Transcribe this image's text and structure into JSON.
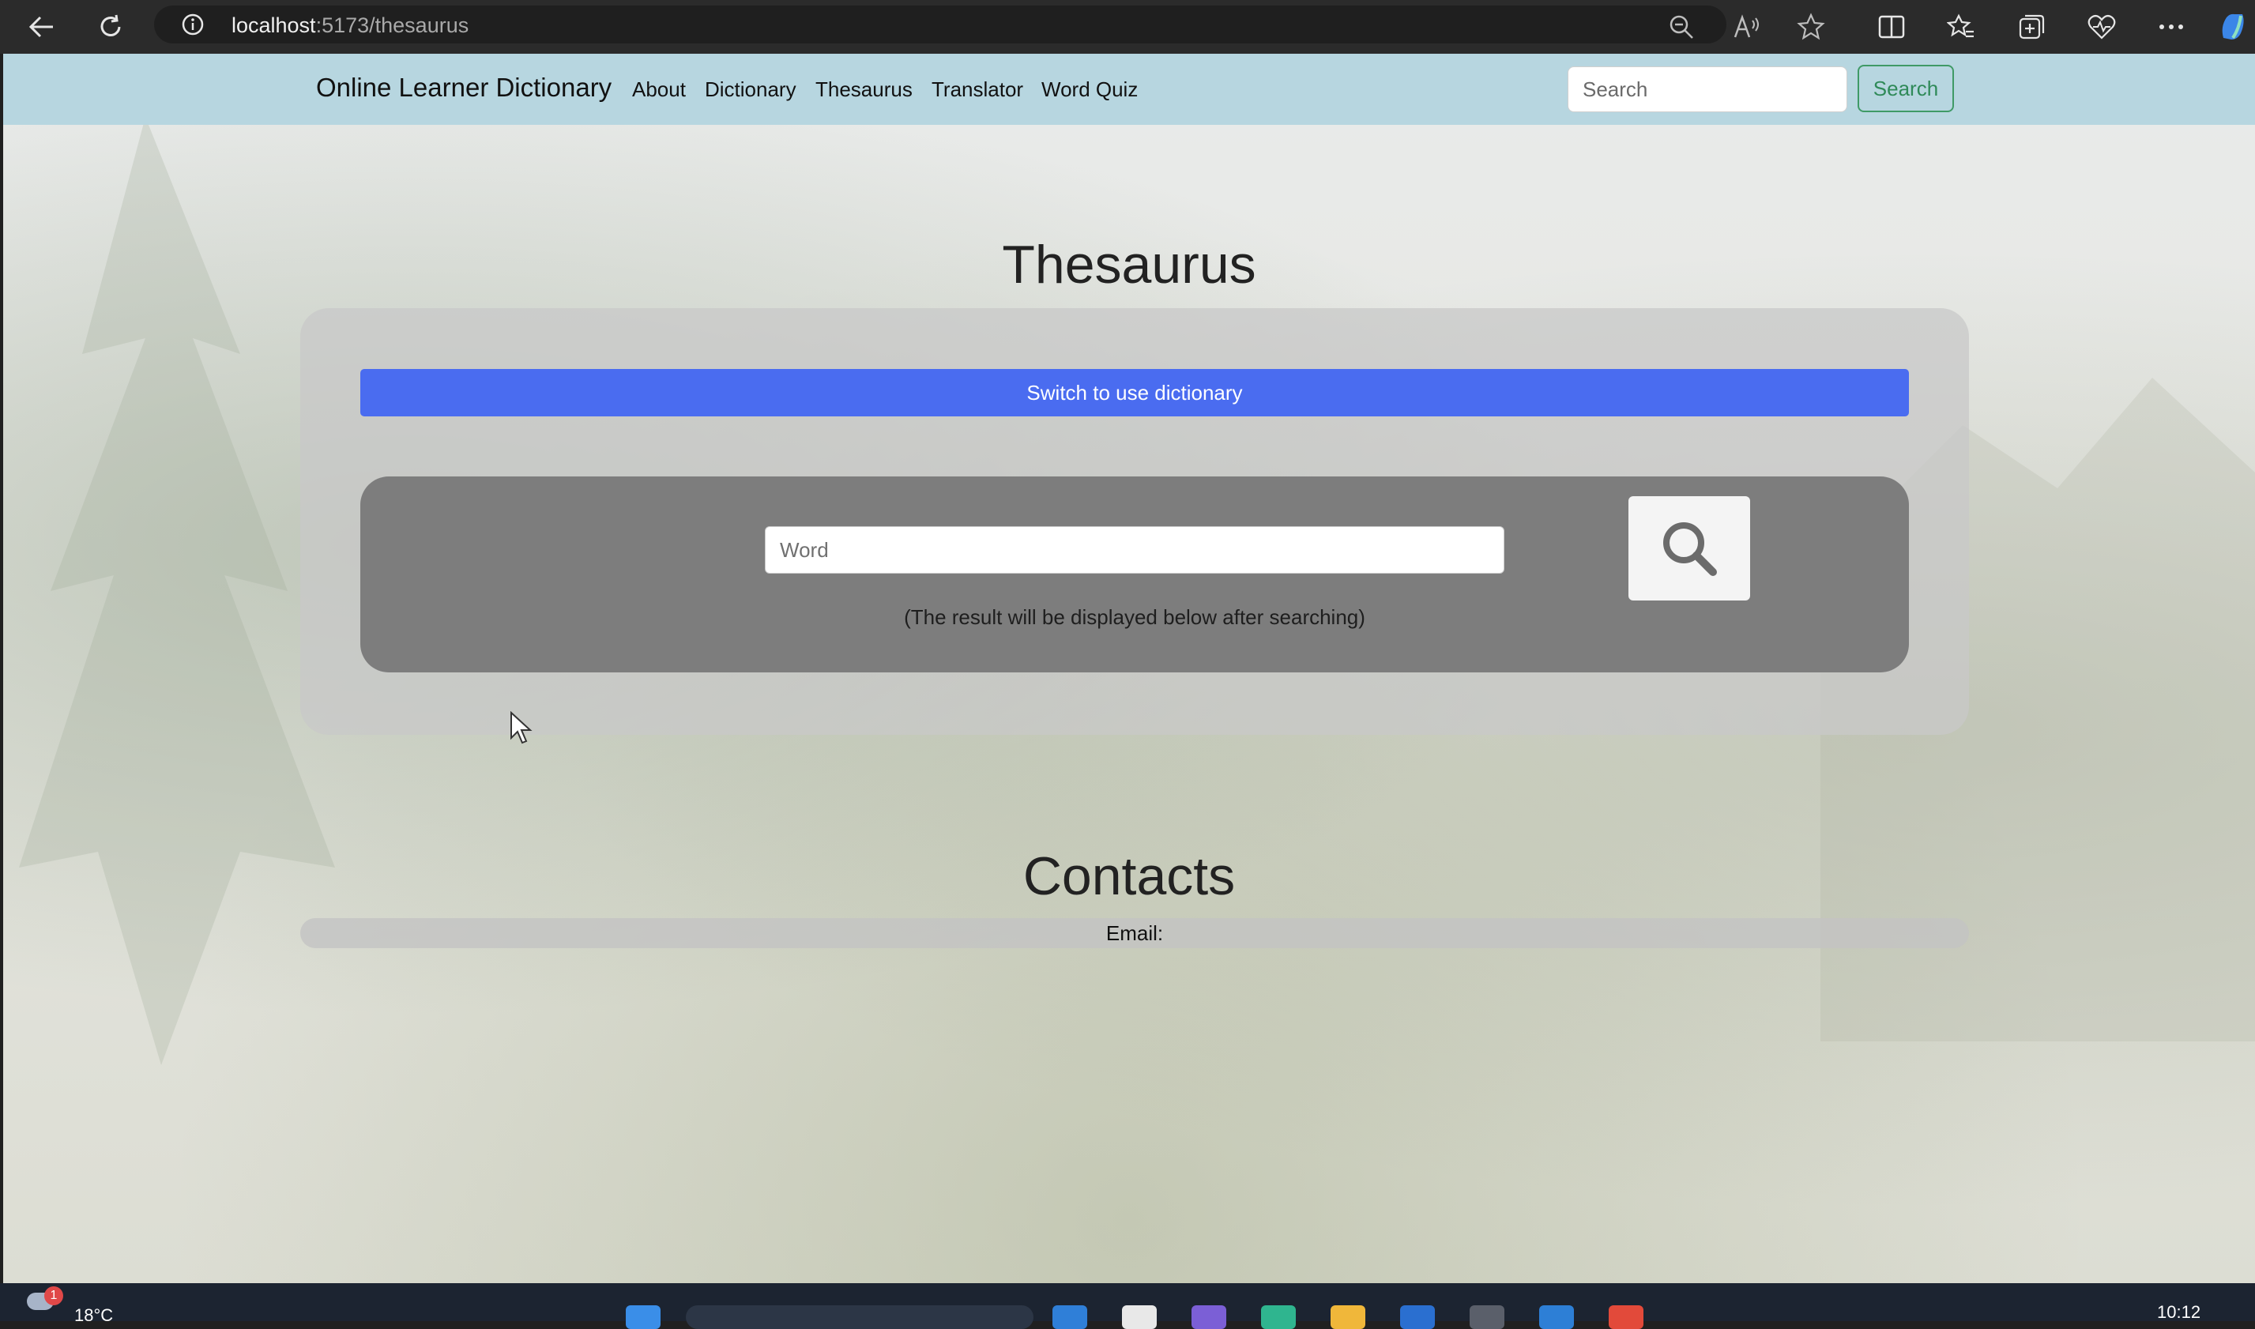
{
  "browser": {
    "url_host": "localhost",
    "url_rest": ":5173/thesaurus"
  },
  "navbar": {
    "brand": "Online Learner Dictionary",
    "links": [
      "About",
      "Dictionary",
      "Thesaurus",
      "Translator",
      "Word Quiz"
    ],
    "search_placeholder": "Search",
    "search_button": "Search"
  },
  "main": {
    "title": "Thesaurus",
    "switch_button": "Switch to use dictionary",
    "word_placeholder": "Word",
    "hint": "(The result will be displayed below after searching)"
  },
  "contacts": {
    "title": "Contacts",
    "email_label": "Email:"
  },
  "taskbar": {
    "weather_badge": "1",
    "temperature": "18°C",
    "clock": "10:12"
  },
  "colors": {
    "navbar_bg": "#b7d6e0",
    "primary_button": "#4a6cf0",
    "outline_success": "#3f9a66",
    "search_panel": "#7d7d7d"
  }
}
